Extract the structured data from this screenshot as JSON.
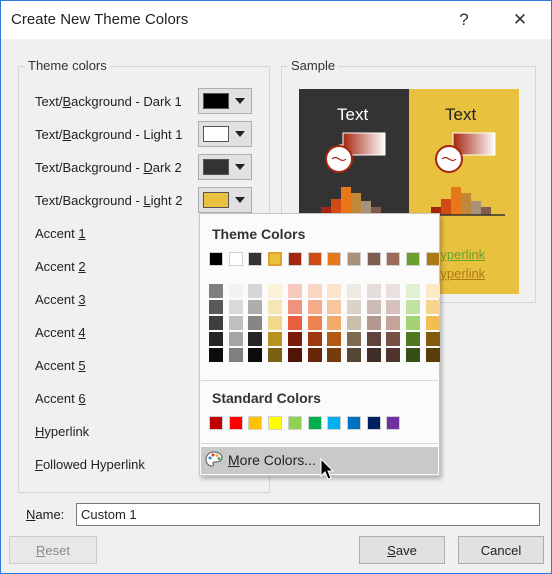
{
  "window": {
    "title": "Create New Theme Colors",
    "help": "?",
    "close": "✕"
  },
  "theme_group": {
    "title": "Theme colors",
    "rows": [
      {
        "pre": "Text/",
        "key": "B",
        "post": "ackground - Dark 1",
        "swatch": "#000000",
        "picker": true
      },
      {
        "pre": "Text/",
        "key": "B",
        "post": "ackground - Light 1",
        "swatch": "#ffffff",
        "picker": true
      },
      {
        "pre": "Text/Background - ",
        "key": "D",
        "post": "ark 2",
        "swatch": "#333333",
        "picker": true
      },
      {
        "pre": "Text/Background - ",
        "key": "L",
        "post": "ight 2",
        "swatch": "#e8c13f",
        "picker": true
      },
      {
        "pre": "Accent ",
        "key": "1",
        "post": "",
        "picker": false
      },
      {
        "pre": "Accent ",
        "key": "2",
        "post": "",
        "picker": false
      },
      {
        "pre": "Accent ",
        "key": "3",
        "post": "",
        "picker": false
      },
      {
        "pre": "Accent ",
        "key": "4",
        "post": "",
        "picker": false
      },
      {
        "pre": "Accent ",
        "key": "5",
        "post": "",
        "picker": false
      },
      {
        "pre": "Accent ",
        "key": "6",
        "post": "",
        "picker": false
      },
      {
        "pre": "",
        "key": "H",
        "post": "yperlink",
        "picker": false
      },
      {
        "pre": "",
        "key": "F",
        "post": "ollowed Hyperlink",
        "picker": false
      }
    ]
  },
  "sample_group": {
    "title": "Sample",
    "dark_text": "Text",
    "light_text": "Text",
    "hyperlink": "Hyperlink",
    "followed": "Hyperlink",
    "colors": {
      "dark_bg": "#333333",
      "light_bg": "#e8c13f",
      "accent1": "#a5260f",
      "accent2": "#e7781a",
      "hyperlink": "#6aa02c",
      "followed": "#b07a13"
    }
  },
  "popup": {
    "theme_title": "Theme Colors",
    "theme_row": [
      "#000000",
      "#ffffff",
      "#333333",
      "#e8c13f",
      "#a5260f",
      "#d24b14",
      "#e7781a",
      "#a89279",
      "#7e5c4f",
      "#9c6b5d",
      "#6aa02c",
      "#b07a13"
    ],
    "shade_grid": [
      [
        "#7f7f7f",
        "#f2f2f2",
        "#d6d6d6",
        "#faf2d9",
        "#f7c9be",
        "#f9d5c4",
        "#fbe3cd",
        "#ede9e3",
        "#e5ddd9",
        "#ebe0dd",
        "#e0f0d0",
        "#fbe9c5"
      ],
      [
        "#595959",
        "#d9d9d9",
        "#adadad",
        "#f5e6b3",
        "#ef937e",
        "#f3ab8a",
        "#f7c79b",
        "#dcd3c8",
        "#cbbcb4",
        "#d7c1bb",
        "#c2e1a2",
        "#f7d48b"
      ],
      [
        "#3f3f3f",
        "#bfbfbf",
        "#858585",
        "#f0d98d",
        "#e85e3e",
        "#ed824f",
        "#f3ab69",
        "#cbbdad",
        "#b1998f",
        "#c3a39a",
        "#a3d173",
        "#f3be51"
      ],
      [
        "#262626",
        "#a5a5a5",
        "#262626",
        "#b8921f",
        "#7c1c0b",
        "#9d380f",
        "#b35a10",
        "#7f6a51",
        "#5e443b",
        "#755045",
        "#4f7821",
        "#845b0e"
      ],
      [
        "#0c0c0c",
        "#7f7f7f",
        "#0c0c0c",
        "#7a6114",
        "#521308",
        "#69260a",
        "#773c0b",
        "#554736",
        "#3f2d27",
        "#4e352e",
        "#355016",
        "#583d09"
      ]
    ],
    "standard_title": "Standard Colors",
    "standard_row": [
      "#c00000",
      "#ff0000",
      "#ffc000",
      "#ffff00",
      "#92d050",
      "#00b050",
      "#00b0f0",
      "#0070c0",
      "#002060",
      "#7030a0"
    ],
    "more_pre": "",
    "more_key": "M",
    "more_post": "ore Colors..."
  },
  "name_field": {
    "label_key": "N",
    "label_post": "ame:",
    "value": "Custom 1"
  },
  "buttons": {
    "reset_key": "R",
    "reset_post": "eset",
    "save_key": "S",
    "save_post": "ave",
    "cancel": "Cancel"
  }
}
